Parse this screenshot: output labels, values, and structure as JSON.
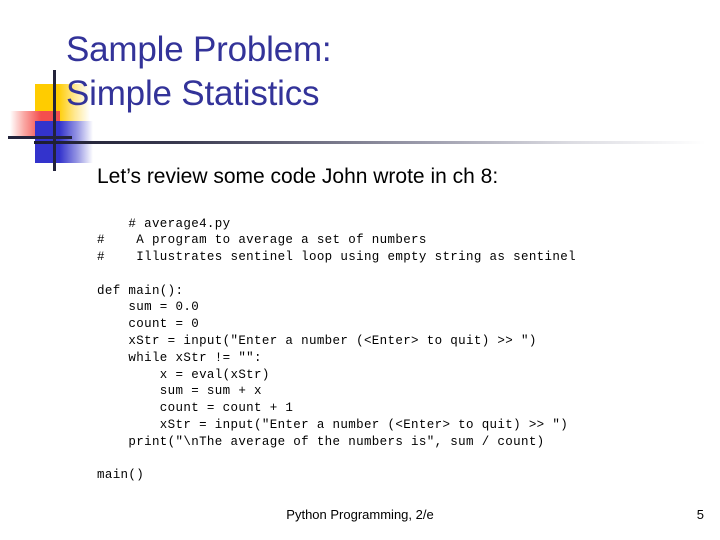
{
  "slide": {
    "title": "Sample Problem:\nSimple Statistics",
    "subtitle": "Let’s review some code John wrote in ch 8:",
    "code": "    # average4.py\n#    A program to average a set of numbers\n#    Illustrates sentinel loop using empty string as sentinel\n\ndef main():\n    sum = 0.0\n    count = 0\n    xStr = input(\"Enter a number (<Enter> to quit) >> \")\n    while xStr != \"\":\n        x = eval(xStr)\n        sum = sum + x\n        count = count + 1\n        xStr = input(\"Enter a number (<Enter> to quit) >> \")\n    print(\"\\nThe average of the numbers is\", sum / count)\n\nmain()",
    "footer": {
      "text": "Python Programming, 2/e",
      "page_number": "5"
    },
    "colors": {
      "title": "#333399",
      "body": "#000000",
      "deco_yellow": "#FFCC00",
      "deco_red": "#F44E4E",
      "deco_blue": "#3333CC",
      "deco_cross": "#23233B",
      "background": "#FFFFFF"
    }
  }
}
